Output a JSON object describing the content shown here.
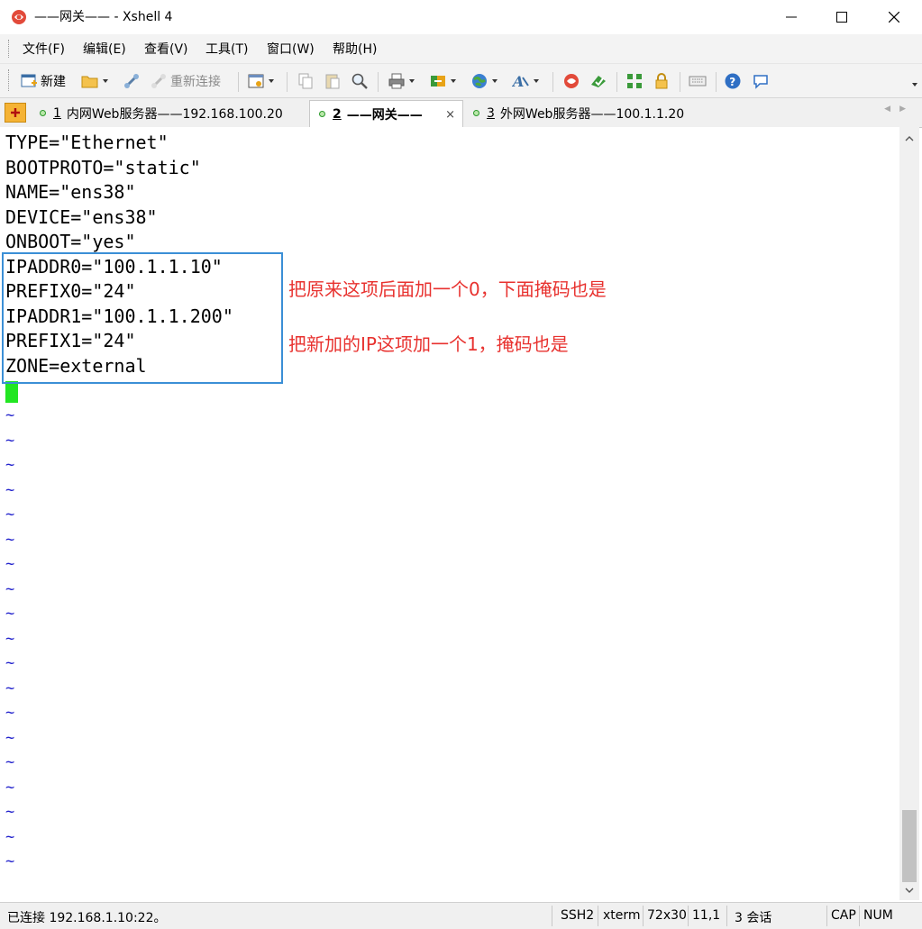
{
  "window": {
    "title": "——网关—— - Xshell 4"
  },
  "menu": [
    "文件(F)",
    "编辑(E)",
    "查看(V)",
    "工具(T)",
    "窗口(W)",
    "帮助(H)"
  ],
  "toolbar": {
    "new_label": "新建",
    "reconnect_label": "重新连接"
  },
  "tabs": [
    {
      "num": "1",
      "label": "内网Web服务器——192.168.100.20",
      "active": false
    },
    {
      "num": "2",
      "label": "——网关——",
      "active": true,
      "close": "×"
    },
    {
      "num": "3",
      "label": "外网Web服务器——100.1.1.20",
      "active": false
    }
  ],
  "terminal": {
    "lines": [
      "TYPE=\"Ethernet\"",
      "BOOTPROTO=\"static\"",
      "NAME=\"ens38\"",
      "DEVICE=\"ens38\"",
      "ONBOOT=\"yes\"",
      "IPADDR0=\"100.1.1.10\"",
      "PREFIX0=\"24\"",
      "IPADDR1=\"100.1.1.200\"",
      "PREFIX1=\"24\"",
      "ZONE=external"
    ],
    "tilde": "~",
    "tilde_count": 19
  },
  "annotations": [
    "把原来这项后面加一个0，下面掩码也是",
    "把新加的IP这项加一个1，掩码也是"
  ],
  "status": {
    "connection": "已连接 192.168.1.10:22。",
    "protocol": "SSH2",
    "term": "xterm",
    "size": "72x30",
    "cursor": "11,1",
    "sessions": "3 会话",
    "cap": "CAP",
    "num": "NUM"
  },
  "colors": {
    "annotation": "#e8322f",
    "box": "#3b8fd6",
    "cursor": "#22e622",
    "tilde": "#2222cc"
  }
}
